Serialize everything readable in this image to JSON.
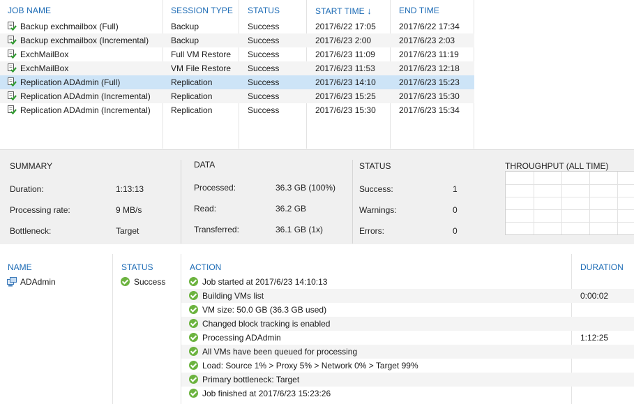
{
  "sessions": {
    "columns": {
      "job_name": "JOB NAME",
      "session_type": "SESSION TYPE",
      "status": "STATUS",
      "start_time": "START TIME",
      "end_time": "END TIME"
    },
    "sort_arrow": "↓",
    "rows": [
      {
        "job_name": "Backup exchmailbox (Full)",
        "session_type": "Backup",
        "status": "Success",
        "start_time": "2017/6/22 17:05",
        "end_time": "2017/6/22 17:34"
      },
      {
        "job_name": "Backup exchmailbox (Incremental)",
        "session_type": "Backup",
        "status": "Success",
        "start_time": "2017/6/23 2:00",
        "end_time": "2017/6/23 2:03"
      },
      {
        "job_name": "ExchMailBox",
        "session_type": "Full VM Restore",
        "status": "Success",
        "start_time": "2017/6/23 11:09",
        "end_time": "2017/6/23 11:19"
      },
      {
        "job_name": "ExchMailBox",
        "session_type": "VM File Restore",
        "status": "Success",
        "start_time": "2017/6/23 11:53",
        "end_time": "2017/6/23 12:18"
      },
      {
        "job_name": "Replication ADAdmin (Full)",
        "session_type": "Replication",
        "status": "Success",
        "start_time": "2017/6/23 14:10",
        "end_time": "2017/6/23 15:23"
      },
      {
        "job_name": "Replication ADAdmin (Incremental)",
        "session_type": "Replication",
        "status": "Success",
        "start_time": "2017/6/23 15:25",
        "end_time": "2017/6/23 15:30"
      },
      {
        "job_name": "Replication ADAdmin (Incremental)",
        "session_type": "Replication",
        "status": "Success",
        "start_time": "2017/6/23 15:30",
        "end_time": "2017/6/23 15:34"
      }
    ],
    "selected_index": 4
  },
  "summary": {
    "summary": {
      "title": "SUMMARY",
      "duration_label": "Duration:",
      "duration": "1:13:13",
      "rate_label": "Processing rate:",
      "rate": "9 MB/s",
      "bottleneck_label": "Bottleneck:",
      "bottleneck": "Target"
    },
    "data": {
      "title": "DATA",
      "processed_label": "Processed:",
      "processed": "36.3 GB (100%)",
      "read_label": "Read:",
      "read": "36.2 GB",
      "transferred_label": "Transferred:",
      "transferred": "36.1 GB (1x)"
    },
    "status": {
      "title": "STATUS",
      "success_label": "Success:",
      "success": "1",
      "warnings_label": "Warnings:",
      "warnings": "0",
      "errors_label": "Errors:",
      "errors": "0"
    },
    "throughput": {
      "title": "THROUGHPUT (ALL TIME)"
    }
  },
  "details": {
    "columns": {
      "name": "NAME",
      "status": "STATUS",
      "action": "ACTION",
      "duration": "DURATION"
    },
    "objects": [
      {
        "name": "ADAdmin",
        "status": "Success"
      }
    ],
    "actions": [
      {
        "text": "Job started at 2017/6/23 14:10:13",
        "duration": ""
      },
      {
        "text": "Building VMs list",
        "duration": "0:00:02"
      },
      {
        "text": "VM size: 50.0 GB (36.3 GB used)",
        "duration": ""
      },
      {
        "text": "Changed block tracking is enabled",
        "duration": ""
      },
      {
        "text": "Processing ADAdmin",
        "duration": "1:12:25"
      },
      {
        "text": "All VMs have been queued for processing",
        "duration": ""
      },
      {
        "text": "Load: Source 1% > Proxy 5% > Network 0% > Target 99%",
        "duration": ""
      },
      {
        "text": "Primary bottleneck: Target",
        "duration": ""
      },
      {
        "text": "Job finished at 2017/6/23 15:23:26",
        "duration": ""
      }
    ]
  }
}
